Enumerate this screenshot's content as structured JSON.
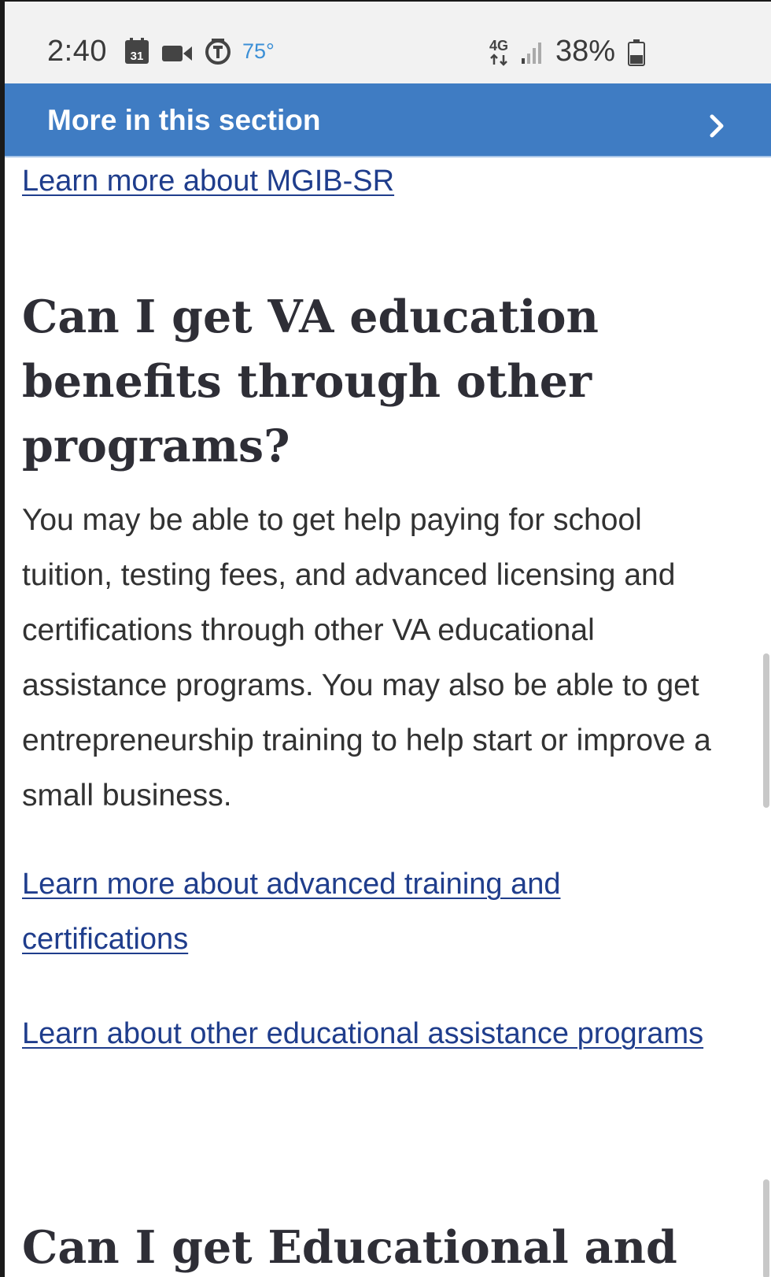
{
  "status_bar": {
    "time": "2:40",
    "calendar_day": "31",
    "temperature": "75°",
    "network": "4G",
    "battery": "38%"
  },
  "section_nav": {
    "label": "More in this section"
  },
  "content": {
    "top_link": "Learn more about MGIB-SR",
    "heading": "Can I get VA education benefits through other programs?",
    "body": "You may be able to get help paying for school tuition, testing fees, and advanced licensing and certifications through other VA educational assistance programs. You may also be able to get entrepreneurship training to help start or improve a small business.",
    "link_advanced": "Learn more about advanced training and certifications",
    "link_other_programs": "Learn about other educational assistance programs",
    "next_heading": "Can I get Educational and"
  }
}
